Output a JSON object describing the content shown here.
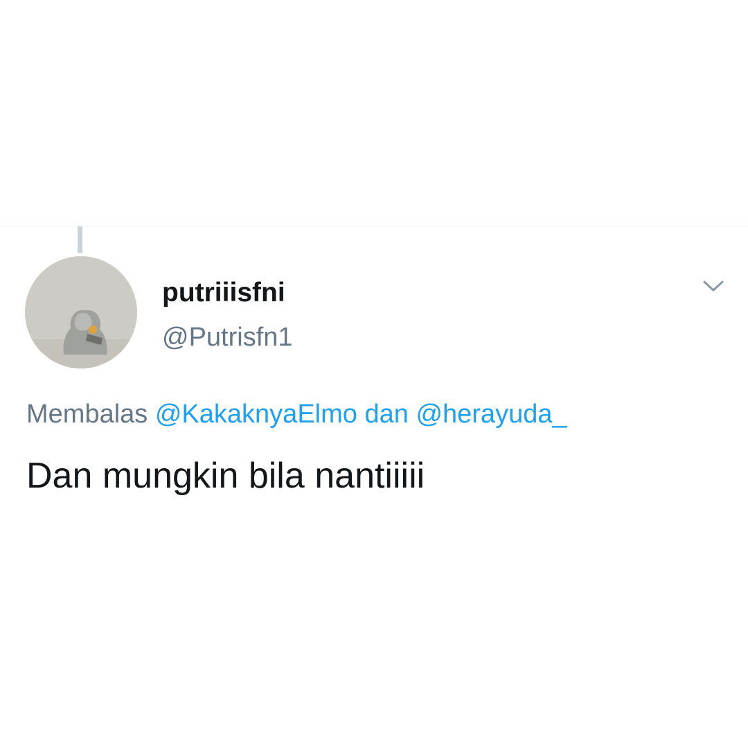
{
  "tweet": {
    "author": {
      "display_name": "putriiisfni",
      "handle": "@Putrisfn1",
      "avatar_icon": "profile-photo"
    },
    "caret_icon": "chevron-down-icon",
    "reply": {
      "prefix": "Membalas",
      "mention_1": "@KakaknyaElmo",
      "conjunction": "dan",
      "mention_2": "@herayuda_"
    },
    "text": "Dan mungkin bila nantiiiii"
  },
  "colors": {
    "primary_text": "#14171a",
    "secondary_text": "#657786",
    "link": "#1da1f2",
    "thread_line": "#c8d2dc"
  }
}
